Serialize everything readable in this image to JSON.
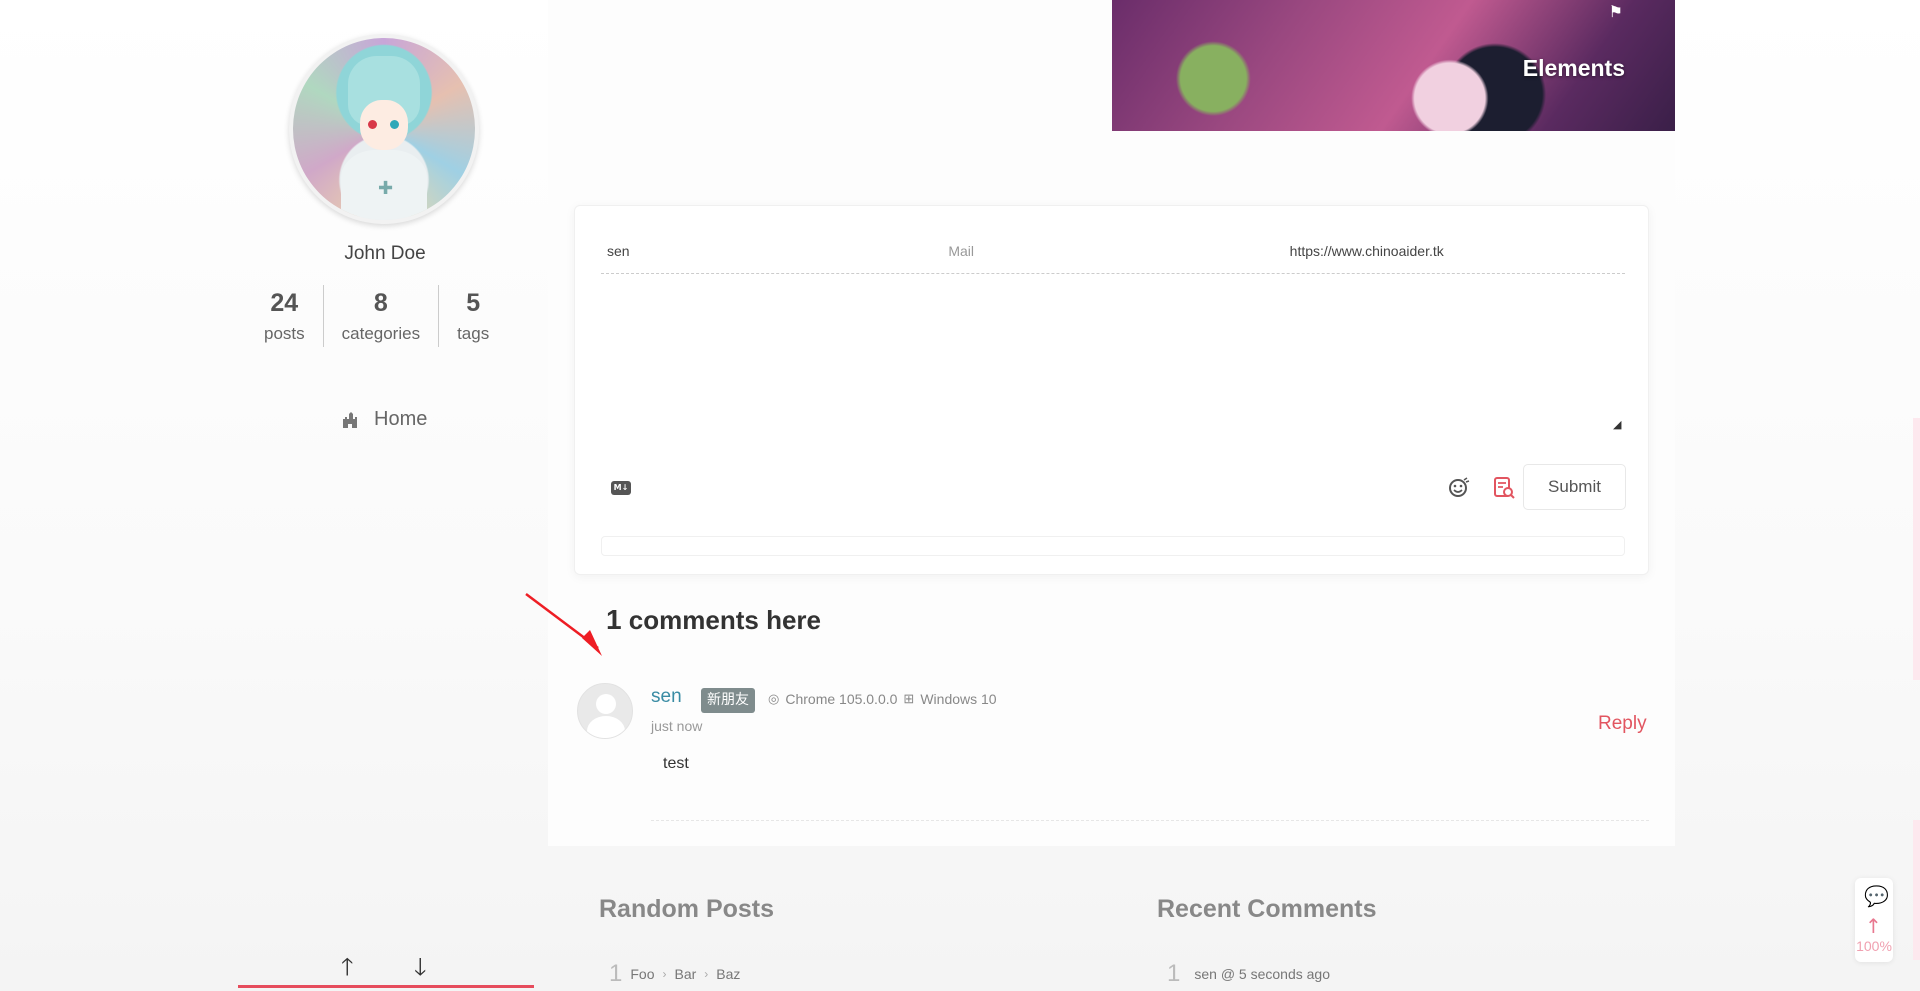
{
  "sidebar": {
    "author_name": "John Doe",
    "stats": [
      {
        "num": "24",
        "label": "posts"
      },
      {
        "num": "8",
        "label": "categories"
      },
      {
        "num": "5",
        "label": "tags"
      }
    ],
    "nav_home": "Home",
    "arrow_up": "🡑",
    "arrow_down": "🡓"
  },
  "banner": {
    "title": "Elements",
    "flag": "⚑"
  },
  "comment_form": {
    "nick_value": "sen",
    "mail_placeholder": "Mail",
    "link_value": "https://www.chinoaider.tk",
    "md_label": "M↓",
    "submit_label": "Submit"
  },
  "comments": {
    "count": "1",
    "count_suffix": " comments here",
    "items": [
      {
        "nick": "sen",
        "badge": "新朋友",
        "browser": "Chrome 105.0.0.0",
        "os": "Windows 10",
        "time": "just now",
        "reply_label": "Reply",
        "content": "test"
      }
    ]
  },
  "footer": {
    "random_posts_title": "Random Posts",
    "random_posts": [
      {
        "index": "1",
        "crumbs": [
          "Foo",
          "Bar",
          "Baz"
        ]
      }
    ],
    "recent_comments_title": "Recent Comments",
    "recent_comments": [
      {
        "index": "1",
        "text": "sen @ 5 seconds ago"
      }
    ]
  },
  "float_tools": {
    "progress": "100%"
  },
  "colors": {
    "accent": "#e25560",
    "nick": "#3a8ca4",
    "badge": "#7f8c8d",
    "bar": "#e64c5c"
  },
  "icons": {
    "home": "castle-icon",
    "md": "markdown-icon",
    "emoji": "emoji-icon",
    "preview": "preview-icon",
    "chrome": "chrome-icon",
    "windows": "windows-icon",
    "chat": "chat-icon",
    "up": "arrow-up-icon"
  }
}
